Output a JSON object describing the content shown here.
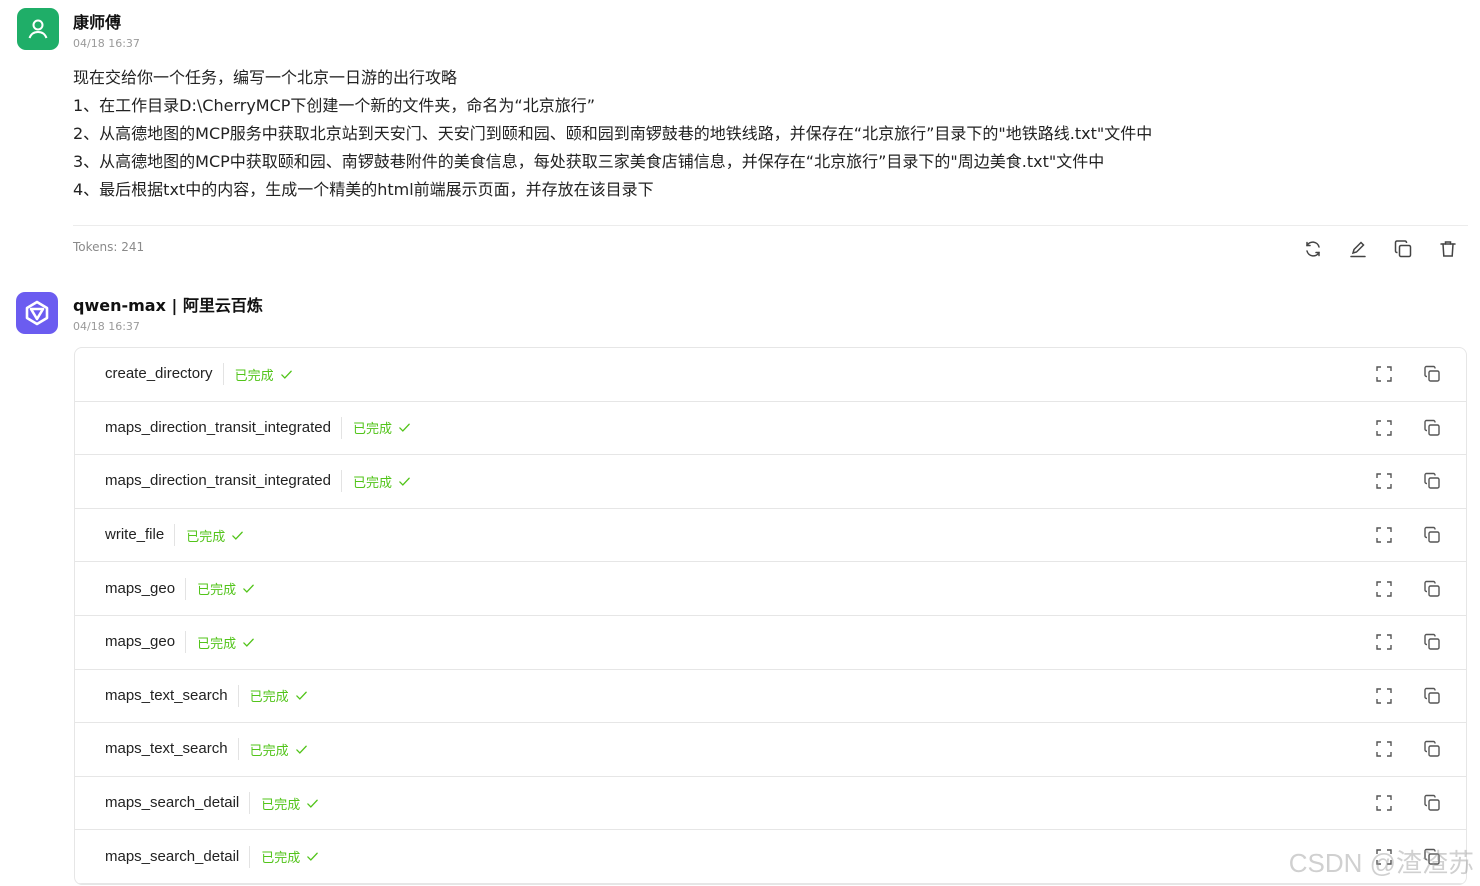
{
  "user_message": {
    "name": "康师傅",
    "time": "04/18 16:37",
    "lines": [
      "现在交给你一个任务，编写一个北京一日游的出行攻略",
      "1、在工作目录D:\\CherryMCP下创建一个新的文件夹，命名为“北京旅行”",
      "2、从高德地图的MCP服务中获取北京站到天安门、天安门到颐和园、颐和园到南锣鼓巷的地铁线路，并保存在“北京旅行”目录下的\"地铁路线.txt\"文件中",
      "3、从高德地图的MCP中获取颐和园、南锣鼓巷附件的美食信息，每处获取三家美食店铺信息，并保存在“北京旅行”目录下的\"周边美食.txt\"文件中",
      "4、最后根据txt中的内容，生成一个精美的html前端展示页面，并存放在该目录下"
    ],
    "tokens": "Tokens: 241",
    "actions": [
      "refresh-icon",
      "edit-icon",
      "copy-icon",
      "delete-icon"
    ]
  },
  "assistant_message": {
    "name": "qwen-max | 阿里云百炼",
    "time": "04/18 16:37",
    "tool_calls": [
      {
        "name": "create_directory",
        "status": "已完成"
      },
      {
        "name": "maps_direction_transit_integrated",
        "status": "已完成"
      },
      {
        "name": "maps_direction_transit_integrated",
        "status": "已完成"
      },
      {
        "name": "write_file",
        "status": "已完成"
      },
      {
        "name": "maps_geo",
        "status": "已完成"
      },
      {
        "name": "maps_geo",
        "status": "已完成"
      },
      {
        "name": "maps_text_search",
        "status": "已完成"
      },
      {
        "name": "maps_text_search",
        "status": "已完成"
      },
      {
        "name": "maps_search_detail",
        "status": "已完成"
      },
      {
        "name": "maps_search_detail",
        "status": "已完成"
      }
    ]
  },
  "watermark": "CSDN @渣渣苏",
  "colors": {
    "user_avatar": "#1fae68",
    "bot_avatar": "#6b5cf0",
    "status_done": "#52c41a"
  }
}
